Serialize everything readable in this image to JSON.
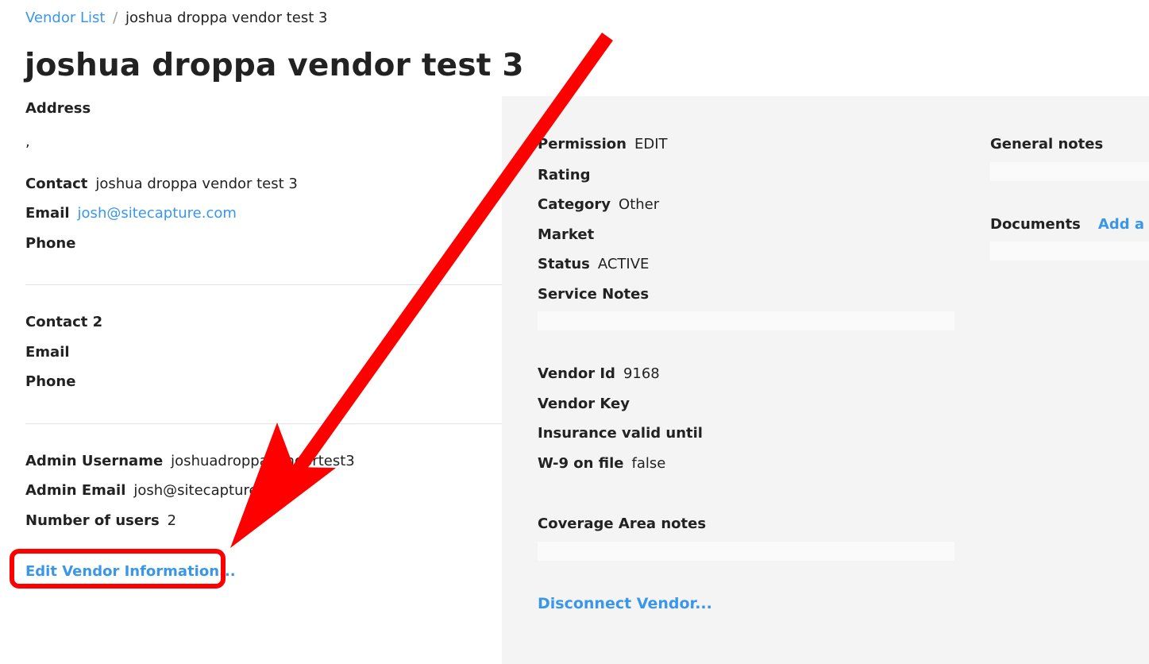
{
  "breadcrumb": {
    "parent": "Vendor List",
    "separator": "/",
    "current": "joshua droppa vendor test 3"
  },
  "title": "joshua droppa vendor test 3",
  "address": {
    "label": "Address",
    "value": ","
  },
  "contact": {
    "contact_label": "Contact",
    "contact_value": "joshua droppa vendor test 3",
    "email_label": "Email",
    "email_value": "josh@sitecapture.com",
    "phone_label": "Phone",
    "phone_value": ""
  },
  "contact2": {
    "contact_label": "Contact 2",
    "contact_value": "",
    "email_label": "Email",
    "email_value": "",
    "phone_label": "Phone",
    "phone_value": ""
  },
  "admin": {
    "username_label": "Admin Username",
    "username_value": "joshuadroppavendortest3",
    "email_label": "Admin Email",
    "email_value": "josh@sitecapture.com",
    "users_label": "Number of users",
    "users_value": "2"
  },
  "edit_link": "Edit Vendor Information...",
  "details": {
    "permission_label": "Permission",
    "permission_value": "EDIT",
    "rating_label": "Rating",
    "rating_value": "",
    "category_label": "Category",
    "category_value": "Other",
    "market_label": "Market",
    "market_value": "",
    "status_label": "Status",
    "status_value": "ACTIVE",
    "service_notes_label": "Service Notes",
    "vendor_id_label": "Vendor Id",
    "vendor_id_value": "9168",
    "vendor_key_label": "Vendor Key",
    "vendor_key_value": "",
    "insurance_label": "Insurance valid until",
    "insurance_value": "",
    "w9_label": "W-9 on file",
    "w9_value": "false",
    "coverage_label": "Coverage Area notes"
  },
  "disconnect_link": "Disconnect Vendor...",
  "side": {
    "general_notes_label": "General notes",
    "documents_label": "Documents",
    "add_document_link": "Add a d"
  },
  "colors": {
    "link": "#3a97e8",
    "annotation": "#ff0000",
    "panel_bg": "#f4f4f4"
  },
  "annotation": {
    "type": "arrow-and-box",
    "target": "Edit Vendor Information..."
  }
}
